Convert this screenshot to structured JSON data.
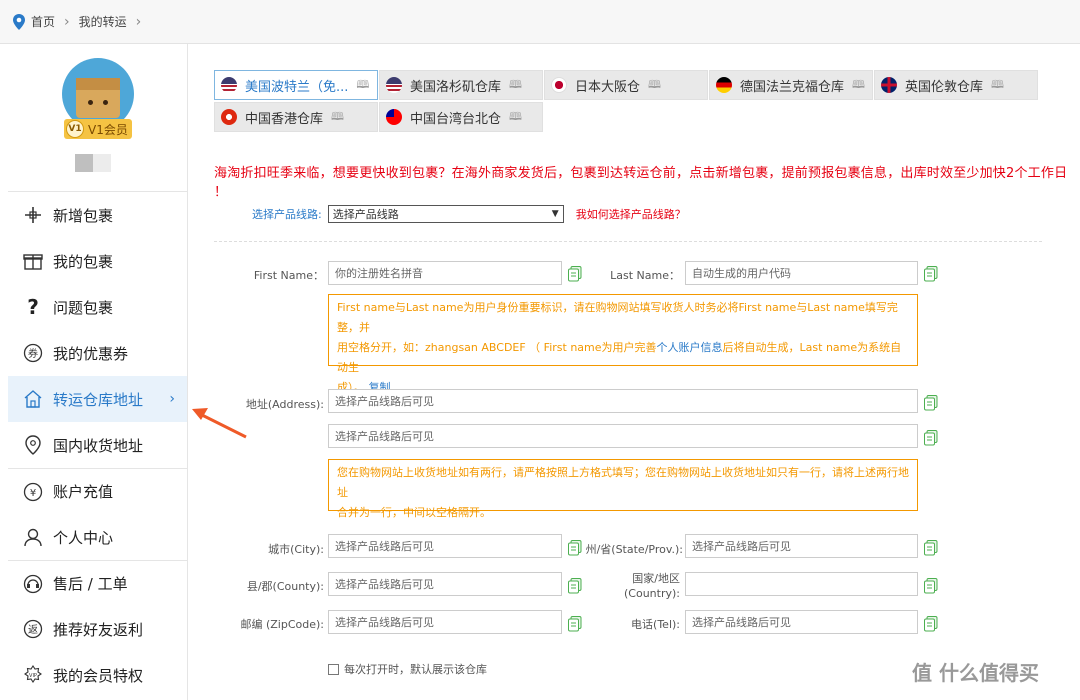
{
  "breadcrumb": {
    "home": "首页",
    "current": "我的转运"
  },
  "profile": {
    "member_badge": "V1会员",
    "badge_code": "V1"
  },
  "sidebar": {
    "items": [
      {
        "label": "新增包裹",
        "icon": "plus-icon"
      },
      {
        "label": "我的包裹",
        "icon": "gift-icon"
      },
      {
        "label": "问题包裹",
        "icon": "question-icon"
      },
      {
        "label": "我的优惠券",
        "icon": "coupon-icon"
      },
      {
        "label": "转运仓库地址",
        "icon": "home-icon",
        "active": true
      },
      {
        "label": "国内收货地址",
        "icon": "location-pin-icon"
      },
      {
        "label": "账户充值",
        "icon": "yen-icon"
      },
      {
        "label": "个人中心",
        "icon": "user-icon"
      },
      {
        "label": "售后 / 工单",
        "icon": "headset-icon"
      },
      {
        "label": "推荐好友返利",
        "icon": "rebate-icon"
      },
      {
        "label": "我的会员特权",
        "icon": "vip-icon"
      }
    ],
    "active_chevron": "›"
  },
  "tabs": [
    {
      "label": "美国波特兰（免...",
      "flag": "us"
    },
    {
      "label": "美国洛杉矶仓库",
      "flag": "us"
    },
    {
      "label": "日本大阪仓",
      "flag": "jp"
    },
    {
      "label": "德国法兰克福仓库",
      "flag": "de"
    },
    {
      "label": "英国伦敦仓库",
      "flag": "uk"
    },
    {
      "label": "中国香港仓库",
      "flag": "hk"
    },
    {
      "label": "中国台湾台北仓",
      "flag": "tw"
    }
  ],
  "notice": "海淘折扣旺季来临，想要更快收到包裹？在海外商家发货后，包裹到达转运仓前，点击新增包裹，提前预报包裹信息，出库时效至少加快2个工作日 ！",
  "route": {
    "label": "选择产品线路:",
    "selected": "选择产品线路",
    "help": "我如何选择产品线路？"
  },
  "form": {
    "first_name_label": "First Name：",
    "first_name_value": "你的注册姓名拼音",
    "last_name_label": "Last Name：",
    "last_name_value": "自动生成的用户代码",
    "name_tip_1": "First name与Last name为用户身份重要标识，请在购物网站填写收货人时务必将First name与Last name填写完整，并",
    "name_tip_2": "用空格分开，如：zhangsan ABCDEF （ First name为用户完善",
    "name_tip_link": "个人账户信息",
    "name_tip_3": "后将自动生成，Last name为系统自动生",
    "name_tip_4": "成）。",
    "name_tip_copy": "复制",
    "address_label": "地址(Address):",
    "address1": "选择产品线路后可见",
    "address2": "选择产品线路后可见",
    "addr_tip_1": "您在购物网站上收货地址如有两行，请严格按照上方格式填写；您在购物网站上收货地址如只有一行，请将上述两行地址",
    "addr_tip_2": "合并为一行，中间以空格隔开。",
    "city_label": "城市(City):",
    "city": "选择产品线路后可见",
    "state_label": "州/省(State/Prov.):",
    "state": "选择产品线路后可见",
    "county_label": "县/郡(County):",
    "county": "选择产品线路后可见",
    "country_label_1": "国家/地区",
    "country_label_2": "(Country):",
    "country": "",
    "zip_label": "邮编 (ZipCode):",
    "zip": "选择产品线路后可见",
    "tel_label": "电话(Tel):",
    "tel": "选择产品线路后可见",
    "default_checkbox": "每次打开时，默认展示该仓库"
  },
  "watermark": "值 什么值得买",
  "colors": {
    "accent": "#2a7ac8",
    "warning": "#f39800",
    "alert": "#e60012",
    "active_bg": "#e8f2fb",
    "arrow": "#ef5a28"
  }
}
